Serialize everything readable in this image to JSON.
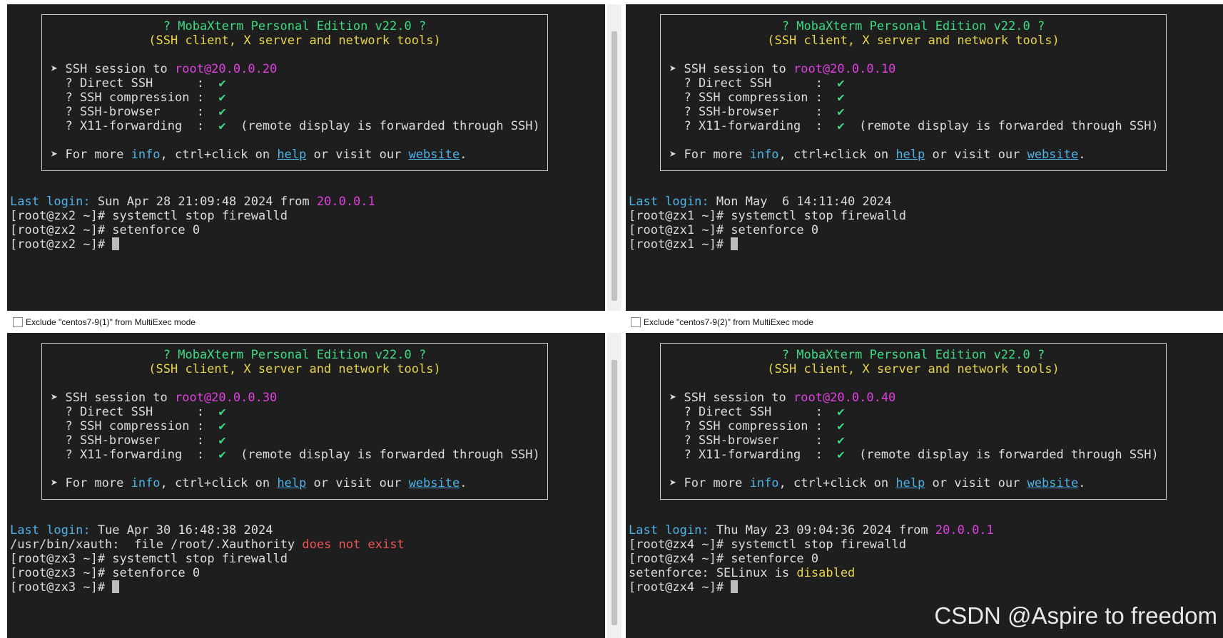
{
  "banner": {
    "title": "? MobaXterm Personal Edition v22.0 ?",
    "subtitle": "(SSH client, X server and network tools)",
    "session_prefix": "➤ SSH session to ",
    "opt_direct": "  ? Direct SSH      :  ",
    "opt_comp": "  ? SSH compression :  ",
    "opt_browser": "  ? SSH-browser     :  ",
    "opt_x11": "  ? X11-forwarding  :  ",
    "check": "✔",
    "x11_note": "  (remote display is forwarded through SSH)",
    "more_prefix": "➤ For more ",
    "more_info": "info",
    "more_mid": ", ctrl+click on ",
    "more_help": "help",
    "more_or": " or visit our ",
    "more_website": "website",
    "more_end": "."
  },
  "last_login_label": "Last login:",
  "from_word": " from ",
  "panes": {
    "tl": {
      "host": "root@20.0.0.20",
      "login_time": " Sun Apr 28 21:09:48 2024",
      "login_from": "20.0.0.1",
      "cmd1": "[root@zx2 ~]# systemctl stop firewalld",
      "cmd2": "[root@zx2 ~]# setenforce 0",
      "prompt": "[root@zx2 ~]# "
    },
    "tr": {
      "host": "root@20.0.0.10",
      "login_time": " Mon May  6 14:11:40 2024",
      "cmd1": "[root@zx1 ~]# systemctl stop firewalld",
      "cmd2": "[root@zx1 ~]# setenforce 0",
      "prompt": "[root@zx1 ~]# "
    },
    "bl": {
      "host": "root@20.0.0.30",
      "login_time": " Tue Apr 30 16:48:38 2024",
      "xauth_prefix": "/usr/bin/xauth:  file /root/.Xauthority ",
      "xauth_err": "does not exist",
      "cmd1": "[root@zx3 ~]# systemctl stop firewalld",
      "cmd2": "[root@zx3 ~]# setenforce 0",
      "prompt": "[root@zx3 ~]# "
    },
    "br": {
      "host": "root@20.0.0.40",
      "login_time": " Thu May 23 09:04:36 2024",
      "login_from": "20.0.0.1",
      "cmd1": "[root@zx4 ~]# systemctl stop firewalld",
      "cmd2": "[root@zx4 ~]# setenforce 0",
      "se_prefix": "setenforce: SELinux is ",
      "se_state": "disabled",
      "prompt": "[root@zx4 ~]# "
    }
  },
  "exclude": {
    "left": "Exclude \"centos7-9(1)\" from MultiExec mode",
    "right": "Exclude \"centos7-9(2)\" from MultiExec mode"
  },
  "watermark": "CSDN @Aspire to freedom"
}
